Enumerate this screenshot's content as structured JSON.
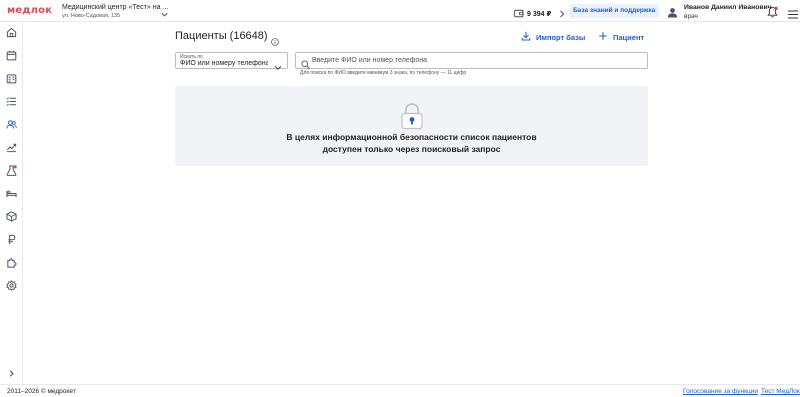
{
  "header": {
    "logo": "медлок",
    "clinic_name": "Медицинский центр «Тест» на ...",
    "clinic_address": "ул. Ново-Садовая, 135",
    "balance": "9 394 ₽",
    "kb_button": "База знаний и поддержка",
    "user_name": "Иванов Даниил Иванович",
    "user_role": "врач"
  },
  "sidebar": {
    "items": [
      {
        "icon": "home-icon"
      },
      {
        "icon": "calendar-icon"
      },
      {
        "icon": "schedule-icon"
      },
      {
        "icon": "list-icon"
      },
      {
        "icon": "patients-icon"
      },
      {
        "icon": "analytics-icon"
      },
      {
        "icon": "lab-icon"
      },
      {
        "icon": "bed-icon"
      },
      {
        "icon": "box-icon"
      },
      {
        "icon": "ruble-icon"
      },
      {
        "icon": "puzzle-icon"
      },
      {
        "icon": "settings-icon"
      }
    ],
    "active_index": 4
  },
  "main": {
    "title": "Пациенты (16648)",
    "import_label": "Импорт базы",
    "add_label": "Пациент",
    "search_by_label": "Искать по",
    "search_by_value": "ФИО или номеру телефона",
    "search_placeholder": "Введите ФИО или номер телефона",
    "search_value": "",
    "hint": "Для поиска по ФИО введите минимум 3 знака, по телефону — 11 цифр",
    "notice_line1": "В целях информационной безопасности список пациентов",
    "notice_line2": "доступен только через поисковый запрос"
  },
  "footer": {
    "copyright": "2011–2026 © медрокет",
    "vote_link": "Голосование за функции",
    "test_link": "Тест МедЛок"
  },
  "colors": {
    "brand": "#e24b50",
    "accent": "#1f5fcf",
    "notice_bg": "#f1f3f7"
  }
}
